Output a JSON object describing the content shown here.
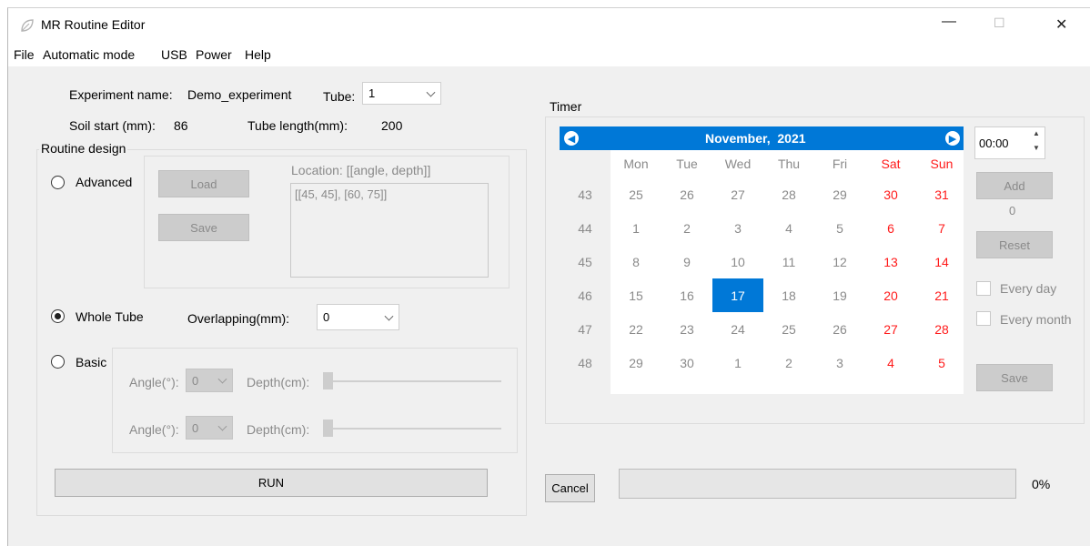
{
  "window": {
    "title": "MR Routine Editor",
    "controls": {
      "minimize": "—",
      "maximize": "☐",
      "close": "✕"
    }
  },
  "menu": [
    "File",
    "Automatic mode",
    "USB",
    "Power",
    "Help"
  ],
  "experiment": {
    "name_label": "Experiment name:",
    "name_value": "Demo_experiment",
    "tube_label": "Tube:",
    "tube_value": "1",
    "soil_label": "Soil start (mm):",
    "soil_value": "86",
    "tube_length_label": "Tube length(mm):",
    "tube_length_value": "200"
  },
  "routine": {
    "group_label": "Routine design",
    "advanced_label": "Advanced",
    "load_label": "Load",
    "save_label": "Save",
    "location_label": "Location: [[angle, depth]]",
    "location_value": "[[45, 45], [60, 75]]",
    "whole_tube_label": "Whole Tube",
    "overlapping_label": "Overlapping(mm):",
    "overlapping_value": "0",
    "basic_label": "Basic",
    "angle_label_1": "Angle(°):",
    "angle_value_1": "0",
    "depth_label_1": "Depth(cm):",
    "angle_label_2": "Angle(°):",
    "angle_value_2": "0",
    "depth_label_2": "Depth(cm):",
    "selected": "whole_tube"
  },
  "timer": {
    "group_label": "Timer",
    "month_year": "November,  2021",
    "prev_icon": "left-arrow-icon",
    "next_icon": "right-arrow-icon",
    "weekdays": [
      "Mon",
      "Tue",
      "Wed",
      "Thu",
      "Fri",
      "Sat",
      "Sun"
    ],
    "weeks": [
      {
        "num": "43",
        "days": [
          "25",
          "26",
          "27",
          "28",
          "29",
          "30",
          "31"
        ]
      },
      {
        "num": "44",
        "days": [
          "1",
          "2",
          "3",
          "4",
          "5",
          "6",
          "7"
        ]
      },
      {
        "num": "45",
        "days": [
          "8",
          "9",
          "10",
          "11",
          "12",
          "13",
          "14"
        ]
      },
      {
        "num": "46",
        "days": [
          "15",
          "16",
          "17",
          "18",
          "19",
          "20",
          "21"
        ]
      },
      {
        "num": "47",
        "days": [
          "22",
          "23",
          "24",
          "25",
          "26",
          "27",
          "28"
        ]
      },
      {
        "num": "48",
        "days": [
          "29",
          "30",
          "1",
          "2",
          "3",
          "4",
          "5"
        ]
      }
    ],
    "selected_day": "17",
    "time_value": "00:00",
    "add_label": "Add",
    "count_value": "0",
    "reset_label": "Reset",
    "every_day_label": "Every day",
    "every_month_label": "Every month",
    "save_label": "Save",
    "accent_color": "#0078d7",
    "weekend_color": "#ff1a1a"
  },
  "footer": {
    "run_label": "RUN",
    "cancel_label": "Cancel",
    "progress_value": 0,
    "progress_text": "0%"
  }
}
